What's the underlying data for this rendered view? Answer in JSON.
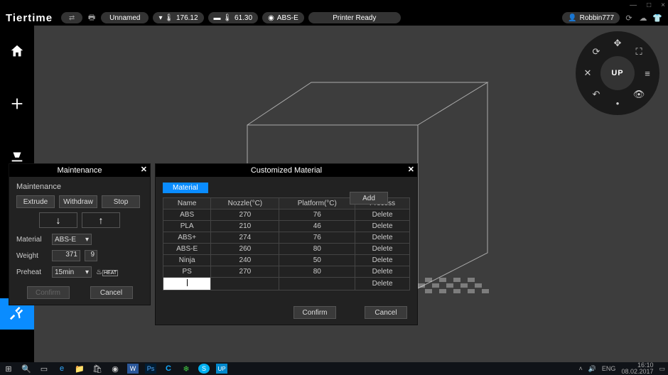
{
  "window": {
    "minimize": "—",
    "maximize": "□",
    "close": "×"
  },
  "brand": "Tiertime",
  "topbar": {
    "file": "Unnamed",
    "nozzle_temp": "176.12",
    "platform_temp": "61.30",
    "material": "ABS-E",
    "status": "Printer Ready",
    "user": "Robbin777"
  },
  "nav": {
    "center": "UP"
  },
  "maintenance": {
    "title": "Maintenance",
    "section": "Maintenance",
    "extrude": "Extrude",
    "withdraw": "Withdraw",
    "stop": "Stop",
    "material_label": "Material",
    "material_value": "ABS-E",
    "weight_label": "Weight",
    "weight_value": "371",
    "weight_unit": "9",
    "preheat_label": "Preheat",
    "preheat_value": "15min",
    "confirm": "Confirm",
    "cancel": "Cancel"
  },
  "custom_material": {
    "title": "Customized Material",
    "tab": "Material",
    "add": "Add",
    "headers": {
      "name": "Name",
      "nozzle": "Nozzle(°C)",
      "platform": "Platform(°C)",
      "process": "Process"
    },
    "rows": [
      {
        "name": "ABS",
        "nozzle": "270",
        "platform": "76",
        "process": "Delete",
        "dim": true
      },
      {
        "name": "PLA",
        "nozzle": "210",
        "platform": "46",
        "process": "Delete",
        "dim": true
      },
      {
        "name": "ABS+",
        "nozzle": "274",
        "platform": "76",
        "process": "Delete",
        "dim": true
      },
      {
        "name": "ABS-E",
        "nozzle": "260",
        "platform": "80",
        "process": "Delete",
        "dim": false
      },
      {
        "name": "Ninja",
        "nozzle": "240",
        "platform": "50",
        "process": "Delete",
        "dim": false
      },
      {
        "name": "PS",
        "nozzle": "270",
        "platform": "80",
        "process": "Delete",
        "dim": false
      }
    ],
    "last_action": "Delete",
    "confirm": "Confirm",
    "cancel": "Cancel"
  },
  "tray": {
    "lang": "ENG",
    "time": "16:10",
    "date": "08.02.2017"
  }
}
